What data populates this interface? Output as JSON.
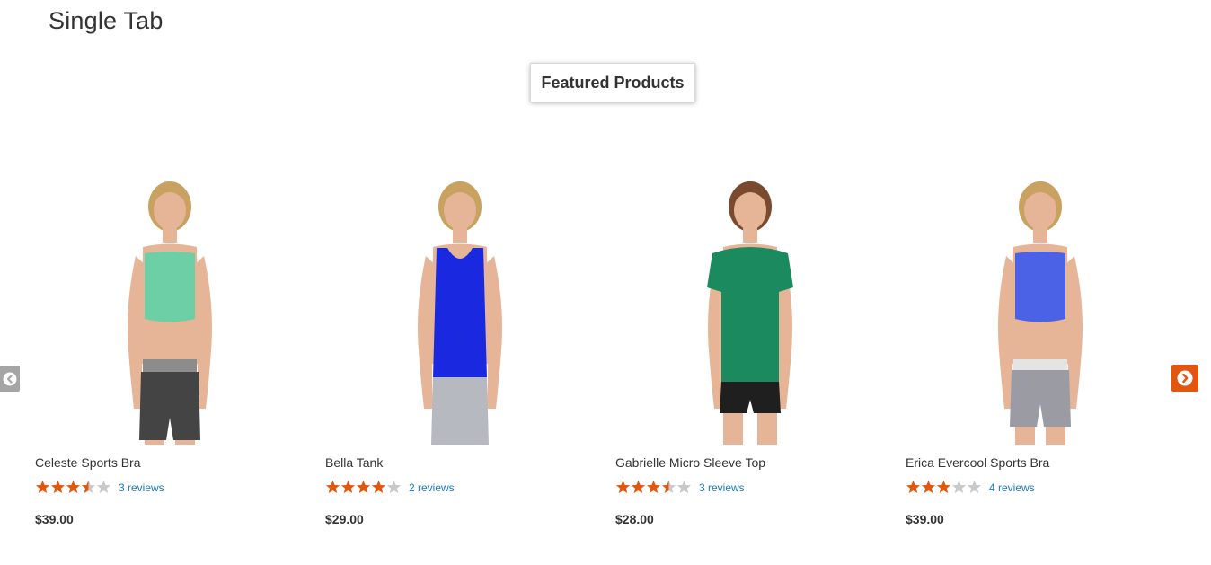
{
  "page": {
    "title": "Single Tab"
  },
  "tabs": [
    {
      "label": "Featured Products",
      "active": true
    }
  ],
  "colors": {
    "star_filled": "#e2570f",
    "star_empty": "#c9c9c9",
    "review_link": "#1979c3",
    "nav_next": "#e2570f",
    "nav_prev": "#a5a5a5"
  },
  "carousel": {
    "prev_icon": "chevron-left-icon",
    "next_icon": "chevron-right-icon"
  },
  "products": [
    {
      "name": "Celeste Sports Bra",
      "rating": 3.5,
      "rating_max": 5,
      "reviews": "3 reviews",
      "price": "$39.00",
      "top_color": "#6ccfa5",
      "bottom_color": "#444444"
    },
    {
      "name": "Bella Tank",
      "rating": 4,
      "rating_max": 5,
      "reviews": "2 reviews",
      "price": "$29.00",
      "top_color": "#1a28e0",
      "bottom_color": "#b7b9c0"
    },
    {
      "name": "Gabrielle Micro Sleeve Top",
      "rating": 3.5,
      "rating_max": 5,
      "reviews": "3 reviews",
      "price": "$28.00",
      "top_color": "#1b8a5e",
      "bottom_color": "#1f1f1f"
    },
    {
      "name": "Erica Evercool Sports Bra",
      "rating": 3,
      "rating_max": 5,
      "reviews": "4 reviews",
      "price": "$39.00",
      "top_color": "#4b61e6",
      "bottom_color": "#9a9ba3"
    }
  ]
}
